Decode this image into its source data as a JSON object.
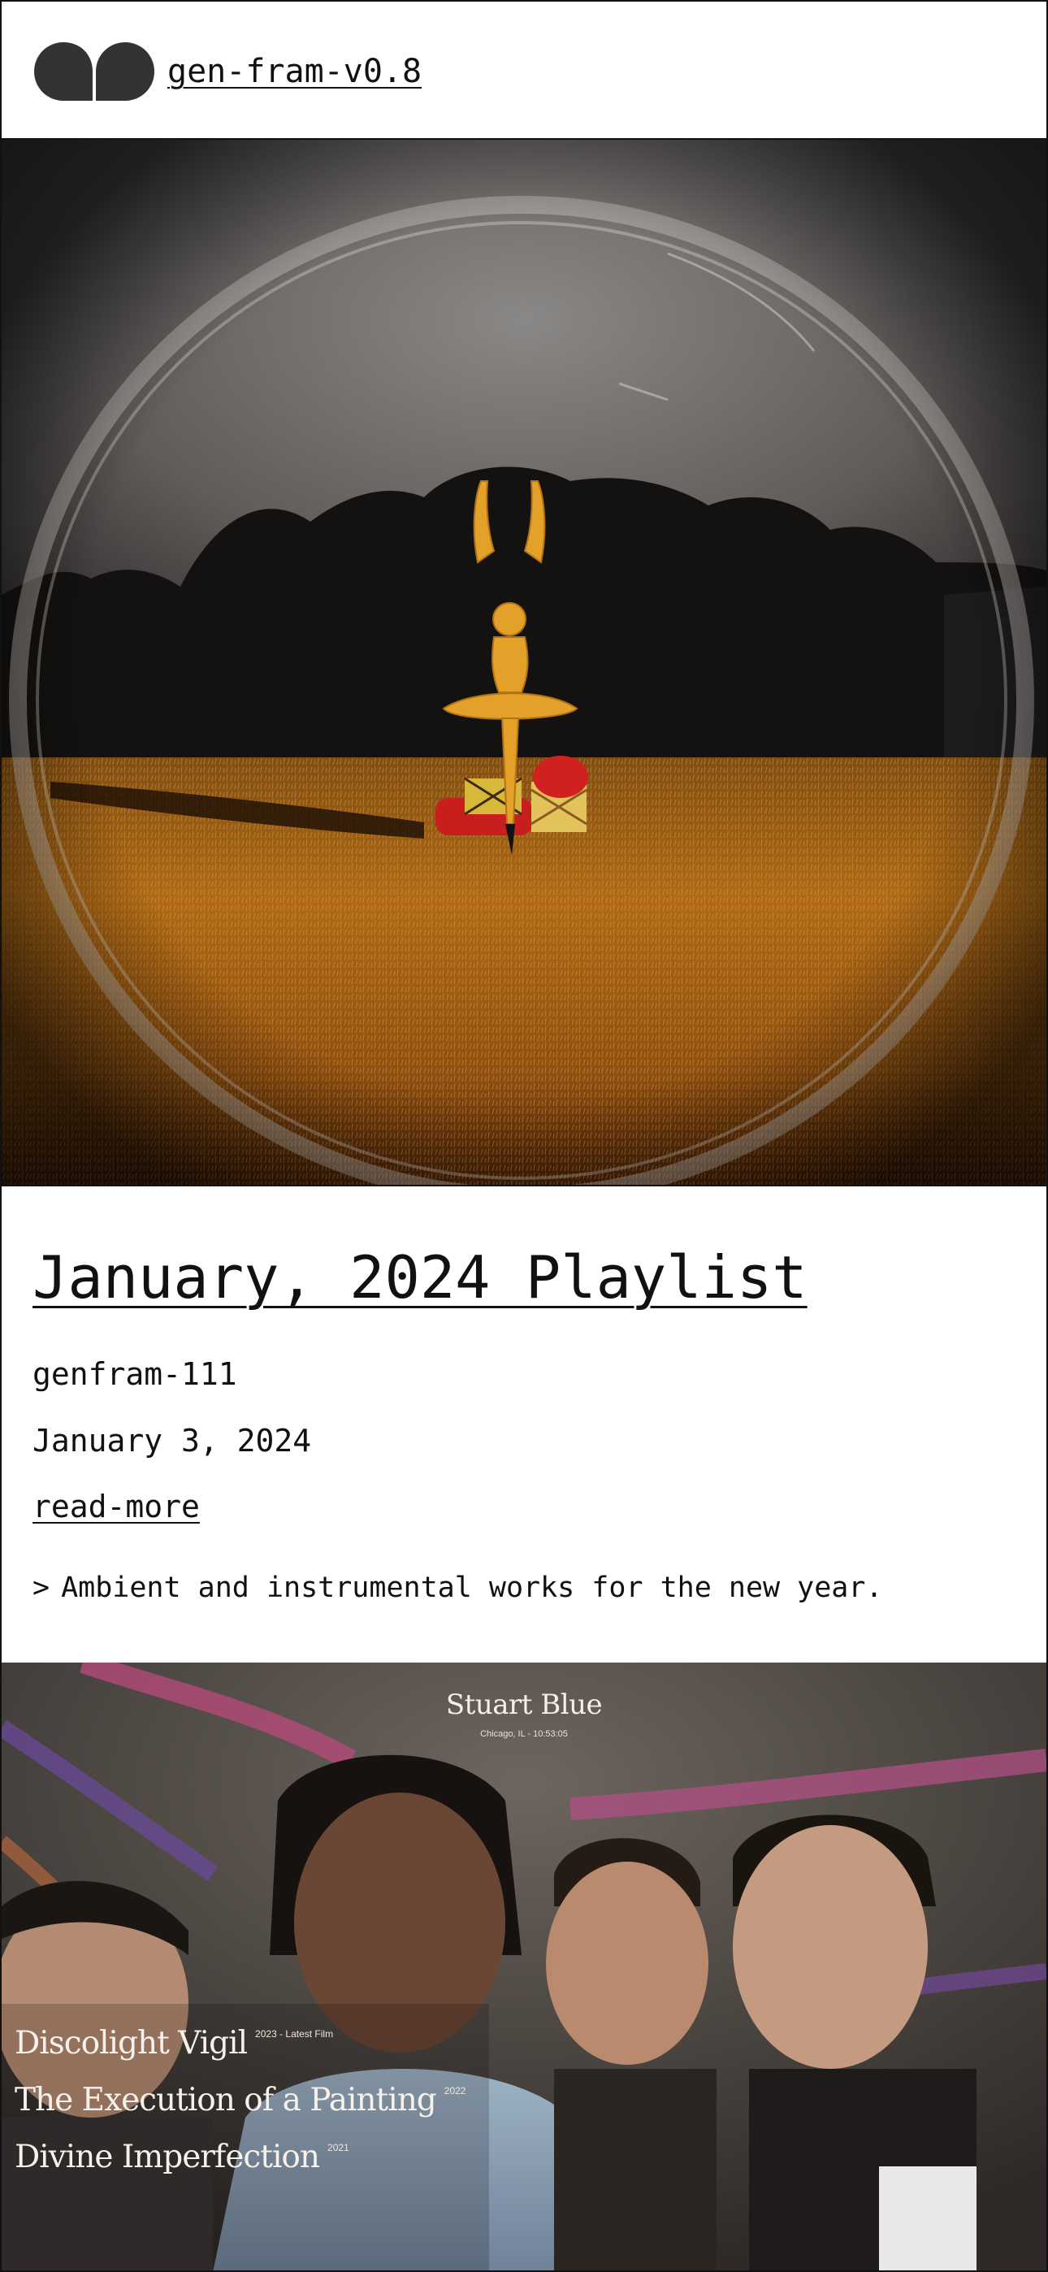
{
  "header": {
    "site_name": "gen-fram-v0.8",
    "logo_icon": "two-blob-logo-icon"
  },
  "hero": {
    "image": "ballerina-figure-in-autumn-field-through-glass-dome"
  },
  "post": {
    "title": "January, 2024 Playlist",
    "id": "genfram-111",
    "date": "January 3, 2024",
    "read_more": "read-more",
    "excerpt_prefix": ">",
    "excerpt": "Ambient and instrumental works for the new year."
  },
  "feature": {
    "image": "four-young-men-under-party-streamers",
    "artist": "Stuart Blue",
    "meta": "Chicago, IL - 10:53:05",
    "works": [
      {
        "title": "Discolight Vigil",
        "note": "2023 - Latest Film"
      },
      {
        "title": "The Execution of a Painting",
        "note": "2022"
      },
      {
        "title": "Divine Imperfection",
        "note": "2021"
      }
    ]
  },
  "colors": {
    "ink": "#111111",
    "background": "#ffffff",
    "field_orange": "#b86a14",
    "dancer_gold": "#e4a12a",
    "overlay_text": "#f6f1ea"
  }
}
